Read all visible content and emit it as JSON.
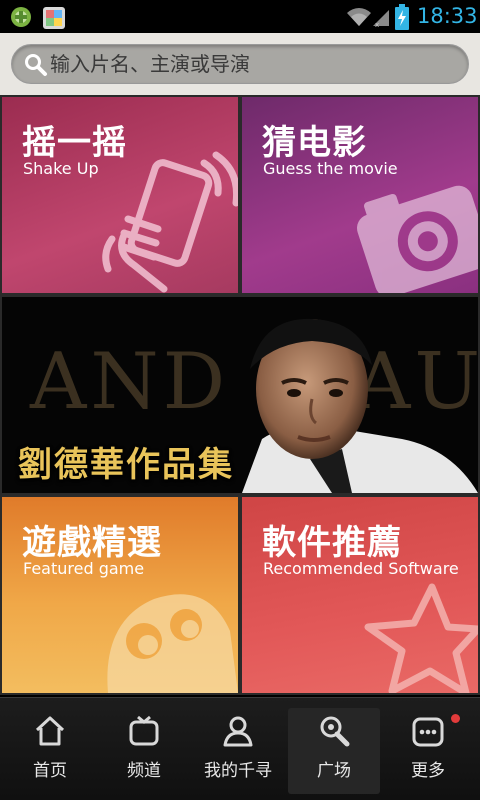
{
  "status_bar": {
    "time": "18:33",
    "icons": [
      "game-app-icon",
      "gallery-app-icon",
      "wifi-icon",
      "signal-icon",
      "battery-charging-icon"
    ],
    "accent": "#33b5e5"
  },
  "search": {
    "placeholder": "输入片名、主演或导演"
  },
  "tiles": {
    "shake": {
      "title": "摇一摇",
      "subtitle": "Shake Up",
      "icon": "shake-phone-icon",
      "color": "#b23e64"
    },
    "guess": {
      "title": "猜电影",
      "subtitle": "Guess the movie",
      "icon": "camera-icon",
      "color": "#93358a"
    },
    "banner": {
      "bg_text_left": "AND",
      "bg_text_right": "AU",
      "caption": "劉德華作品集",
      "caption_color": "#e9c45a"
    },
    "game": {
      "title": "遊戲精選",
      "subtitle": "Featured game",
      "icon": "ghost-face-icon",
      "color": "#ee9a40"
    },
    "software": {
      "title": "軟件推薦",
      "subtitle": "Recommended Software",
      "icon": "star-icon",
      "color": "#dc5252"
    }
  },
  "nav": {
    "items": [
      {
        "label": "首页",
        "icon": "home-icon"
      },
      {
        "label": "频道",
        "icon": "tv-icon"
      },
      {
        "label": "我的千寻",
        "icon": "person-icon"
      },
      {
        "label": "广场",
        "icon": "search-magnifier-icon",
        "active": true
      },
      {
        "label": "更多",
        "icon": "more-icon",
        "badge": true
      }
    ],
    "badge_color": "#e23b3b"
  }
}
